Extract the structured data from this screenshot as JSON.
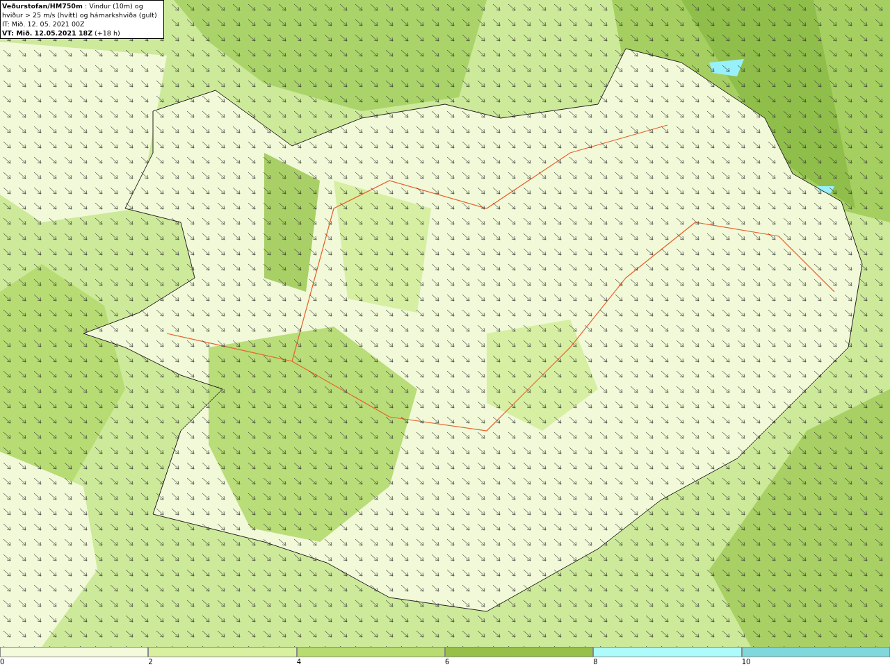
{
  "header": {
    "lines": [
      "**Veðurstofan/HM750m** : Vindur (10m) og",
      "hviður > 25 m/s (hvítt) og hámarkshviða (gult)",
      "IT: Mið. 12. 05. 2021 00Z",
      "**VT: Mið. 12.05.2021 18Z** (+18 h)"
    ]
  },
  "legend": [
    {
      "label": "0",
      "color": "#f4fbdc"
    },
    {
      "label": "2",
      "color": "#d8f0a0"
    },
    {
      "label": "4",
      "color": "#b8dc70"
    },
    {
      "label": "6",
      "color": "#96c048"
    },
    {
      "label": "8",
      "color": "#adfbfb"
    },
    {
      "label": "10",
      "color": "#80d8dc"
    }
  ]
}
